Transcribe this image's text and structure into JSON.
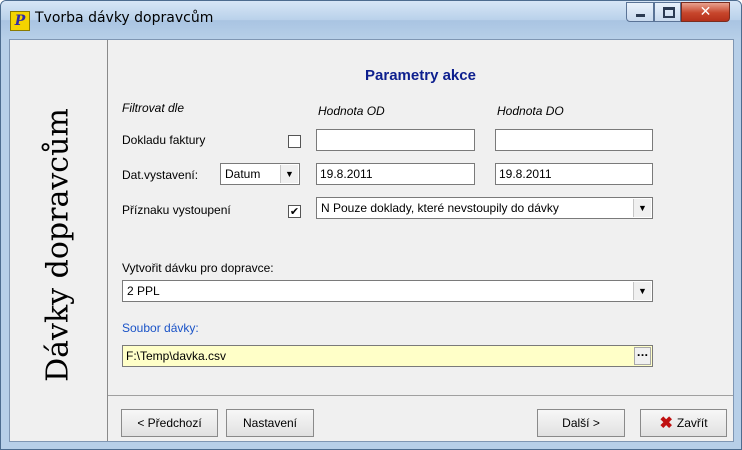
{
  "window": {
    "title": "Tvorba dávky dopravcům",
    "icon_letter": "P",
    "close_glyph": "✕"
  },
  "side": {
    "title": "Dávky dopravcům"
  },
  "main": {
    "section_title": "Parametry akce",
    "header_filter": "Filtrovat dle",
    "header_from": "Hodnota OD",
    "header_to": "Hodnota DO",
    "rows": {
      "invoice": {
        "label": "Dokladu faktury",
        "checked": "",
        "from": "",
        "to": ""
      },
      "issue_date": {
        "label": "Dat.vystavení:",
        "type_value": "Datum",
        "from": "19.8.2011",
        "to": "19.8.2011"
      },
      "entry_flag": {
        "label": "Příznaku vystoupení",
        "checked": "✔",
        "value": "N  Pouze doklady, které nevstoupily do dávky"
      }
    },
    "carrier": {
      "label": "Vytvořit dávku pro dopravce:",
      "value": "2  PPL"
    },
    "file": {
      "label": "Soubor dávky:",
      "value": "F:\\Temp\\davka.csv",
      "browse": "..."
    }
  },
  "buttons": {
    "prev": "< Předchozí",
    "settings": "Nastavení",
    "next": "Další >",
    "close": "Zavřít",
    "close_icon": "✖"
  },
  "colors": {
    "section_title": "#0d1f8e",
    "file_label": "#1a53c7",
    "file_field_bg": "#ffffc8"
  }
}
